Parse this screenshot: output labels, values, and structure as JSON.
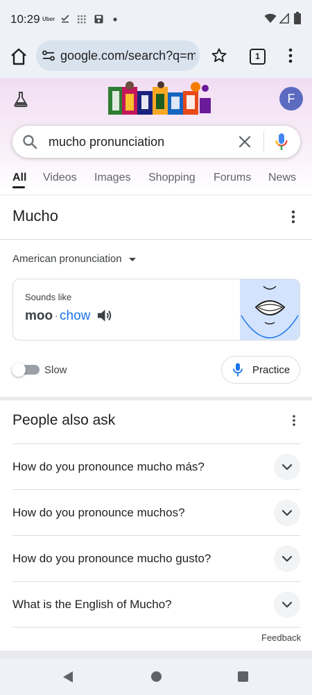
{
  "status_bar": {
    "time": "10:29",
    "uber_label": "Uber"
  },
  "browser": {
    "url": "google.com/search?q=mucho+pronunciation",
    "tab_count": "1"
  },
  "header": {
    "avatar_letter": "F"
  },
  "search": {
    "query": "mucho pronunciation"
  },
  "tabs": [
    {
      "label": "All",
      "active": true
    },
    {
      "label": "Videos"
    },
    {
      "label": "Images"
    },
    {
      "label": "Shopping"
    },
    {
      "label": "Forums"
    },
    {
      "label": "News"
    }
  ],
  "pronunciation": {
    "title": "Mucho",
    "accent": "American pronunciation",
    "sounds_like_label": "Sounds like",
    "syllables": [
      "moo",
      "chow"
    ],
    "separator": "·",
    "slow_label": "Slow",
    "slow_enabled": false,
    "practice_label": "Practice"
  },
  "people_also_ask": {
    "title": "People also ask",
    "questions": [
      "How do you pronounce mucho más?",
      "How do you pronounce muchos?",
      "How do you pronounce mucho gusto?",
      "What is the English of Mucho?"
    ],
    "feedback_label": "Feedback"
  },
  "colors": {
    "accent_blue": "#1a73e8",
    "header_tint": "#f1ddf3",
    "avatar_bg": "#5c6bc0"
  }
}
